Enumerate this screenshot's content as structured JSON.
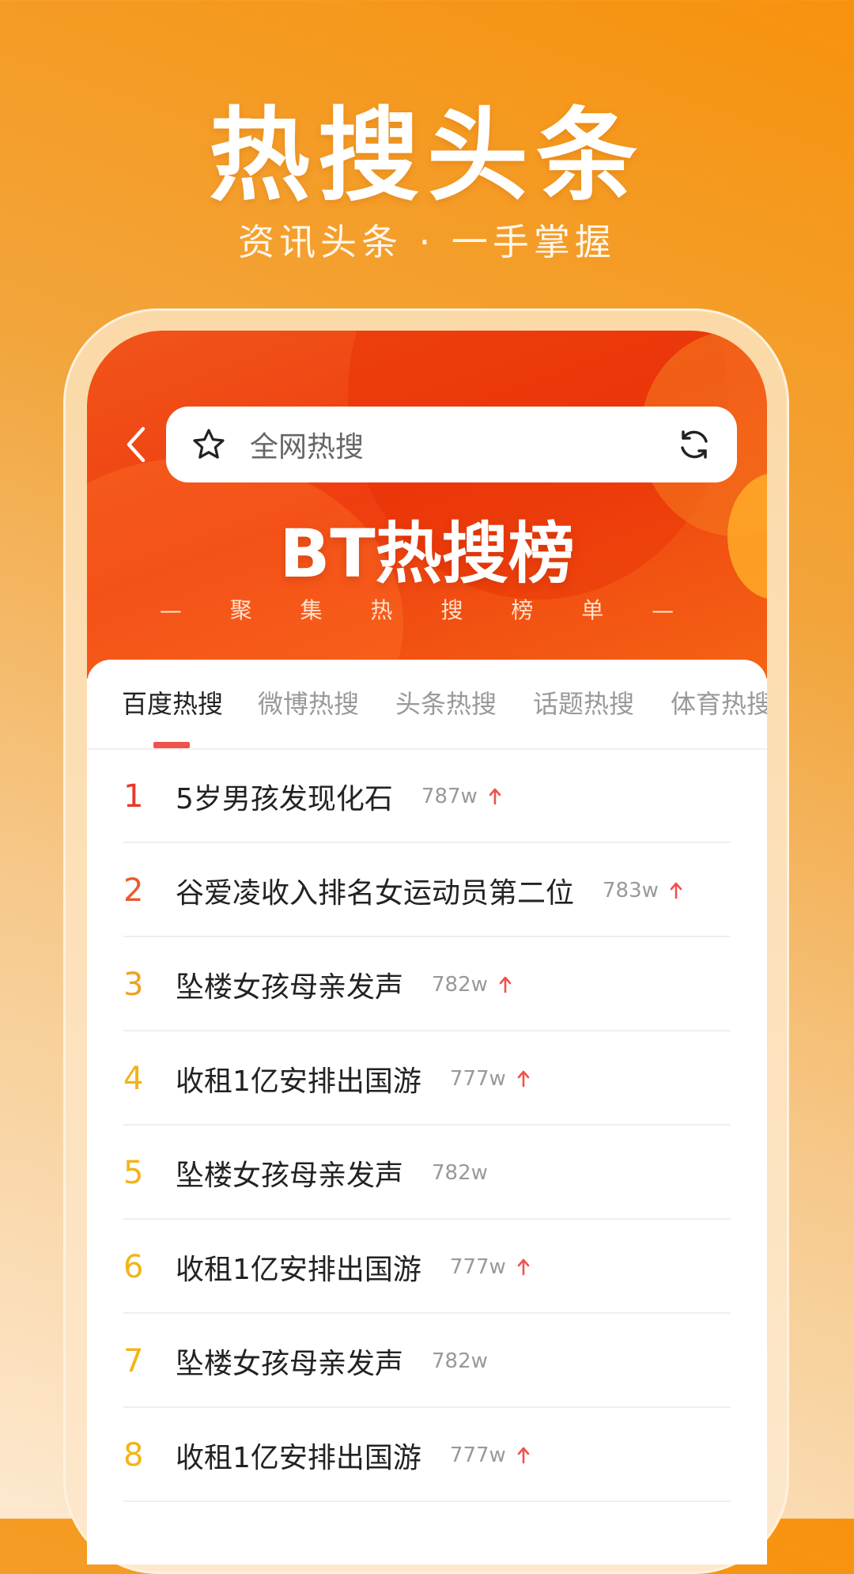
{
  "promo": {
    "title": "热搜头条",
    "subtitle": "资讯头条 · 一手掌握"
  },
  "app": {
    "search": {
      "placeholder": "全网热搜",
      "star_icon": "star-icon",
      "refresh_icon": "refresh-icon",
      "back_icon": "chevron-left-icon"
    },
    "brand": {
      "title": "BT热搜榜",
      "subtitle": "— 聚 集 热 搜 榜 单 —"
    },
    "tabs": [
      {
        "label": "百度热搜",
        "active": true
      },
      {
        "label": "微博热搜",
        "active": false
      },
      {
        "label": "头条热搜",
        "active": false
      },
      {
        "label": "话题热搜",
        "active": false
      },
      {
        "label": "体育热搜",
        "active": false
      }
    ],
    "list": [
      {
        "rank": "1",
        "title": "5岁男孩发现化石",
        "count": "787w",
        "trend_up": true
      },
      {
        "rank": "2",
        "title": "谷爱凌收入排名女运动员第二位",
        "count": "783w",
        "trend_up": true
      },
      {
        "rank": "3",
        "title": "坠楼女孩母亲发声",
        "count": "782w",
        "trend_up": true
      },
      {
        "rank": "4",
        "title": "收租1亿安排出国游",
        "count": "777w",
        "trend_up": true
      },
      {
        "rank": "5",
        "title": "坠楼女孩母亲发声",
        "count": "782w",
        "trend_up": false
      },
      {
        "rank": "6",
        "title": "收租1亿安排出国游",
        "count": "777w",
        "trend_up": true
      },
      {
        "rank": "7",
        "title": "坠楼女孩母亲发声",
        "count": "782w",
        "trend_up": false
      },
      {
        "rank": "8",
        "title": "收租1亿安排出国游",
        "count": "777w",
        "trend_up": true
      }
    ]
  },
  "colors": {
    "rank": [
      "#e8382c",
      "#ec5a2c",
      "#f1a020",
      "#f2b417",
      "#f2b417",
      "#f2b417",
      "#f2b417",
      "#f2b417"
    ],
    "trend": "#f0524c",
    "accent": "#ef3d10"
  }
}
